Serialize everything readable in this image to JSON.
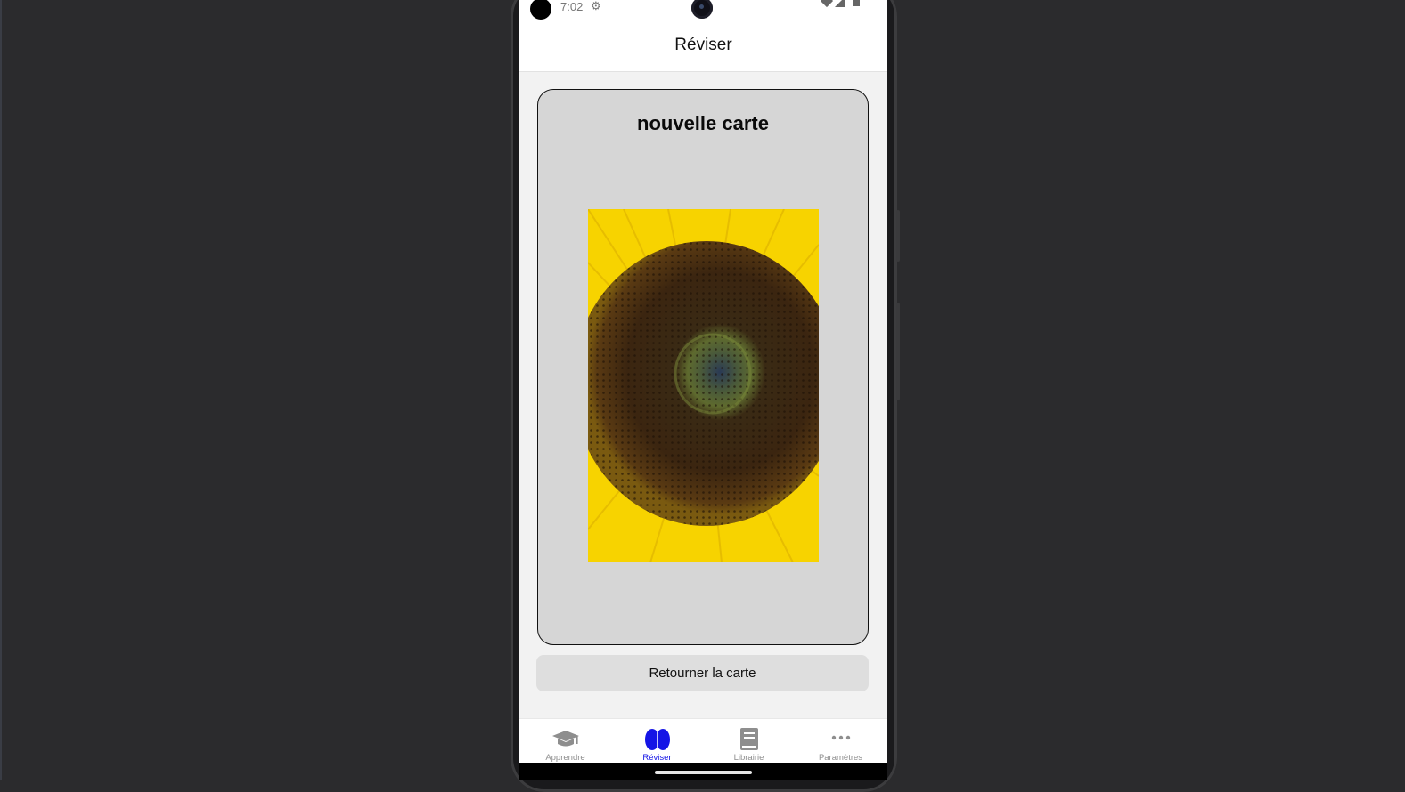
{
  "status_bar": {
    "time": "7:02",
    "settings_icon": "gear-icon"
  },
  "header": {
    "title": "Réviser"
  },
  "card": {
    "title": "nouvelle carte",
    "image": "sunflower-image"
  },
  "actions": {
    "flip_label": "Retourner la carte"
  },
  "tabs": [
    {
      "label": "Apprendre",
      "icon": "graduation-cap-icon",
      "active": false
    },
    {
      "label": "Réviser",
      "icon": "brain-icon",
      "active": true
    },
    {
      "label": "Librairie",
      "icon": "book-icon",
      "active": false
    },
    {
      "label": "Paramètres",
      "icon": "ellipsis-icon",
      "active": false
    }
  ],
  "colors": {
    "active_tab": "#1414e6",
    "inactive_tab": "#8e8e8e",
    "card_bg": "#d6d6d6"
  }
}
